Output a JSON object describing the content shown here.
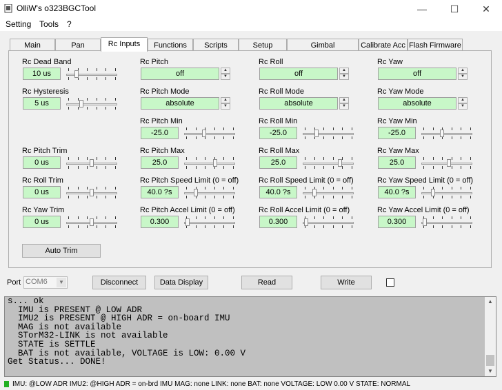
{
  "window": {
    "title": "OlliW's o323BGCTool",
    "min": "—",
    "max": "☐",
    "close": "✕"
  },
  "menu": [
    "Setting",
    "Tools",
    "?"
  ],
  "tabs": [
    "Main",
    "Pan",
    "Rc Inputs",
    "Functions",
    "Scripts",
    "Setup",
    "Gimbal Configuration",
    "Calibrate Acc",
    "Flash Firmware"
  ],
  "col1": {
    "dead_band": {
      "label": "Rc Dead Band",
      "value": "10 us",
      "slider": 0.18
    },
    "hysteresis": {
      "label": "Rc Hysteresis",
      "value": "5 us",
      "slider": 0.28
    },
    "pitch_trim": {
      "label": "Rc Pitch Trim",
      "value": "0 us",
      "slider": 0.5
    },
    "roll_trim": {
      "label": "Rc Roll Trim",
      "value": "0 us",
      "slider": 0.5
    },
    "yaw_trim": {
      "label": "Rc Yaw Trim",
      "value": "0 us",
      "slider": 0.5
    },
    "auto_trim": "Auto Trim"
  },
  "axes": [
    {
      "key": "pitch",
      "rc": "Rc Pitch",
      "rc_val": "off",
      "mode": "Rc Pitch Mode",
      "mode_val": "absolute",
      "min": "Rc Pitch Min",
      "min_val": "-25.0",
      "min_s": 0.38,
      "max": "Rc Pitch Max",
      "max_val": "25.0",
      "max_s": 0.62,
      "speed": "Rc Pitch Speed Limit (0 = off)",
      "speed_val": "40.0 ?s",
      "speed_s": 0.2,
      "accel": "Rc Pitch Accel Limit (0 = off)",
      "accel_val": "0.300",
      "accel_s": 0.03
    },
    {
      "key": "roll",
      "rc": "Rc Roll",
      "rc_val": "off",
      "mode": "Rc Roll Mode",
      "mode_val": "absolute",
      "min": "Rc Roll Min",
      "min_val": "-25.0",
      "min_s": 0.25,
      "max": "Rc Roll Max",
      "max_val": "25.0",
      "max_s": 0.75,
      "speed": "Rc Roll Speed Limit (0 = off)",
      "speed_val": "40.0 ?s",
      "speed_s": 0.2,
      "accel": "Rc Roll Accel Limit (0 = off)",
      "accel_val": "0.300",
      "accel_s": 0.03
    },
    {
      "key": "yaw",
      "rc": "Rc Yaw",
      "rc_val": "off",
      "mode": "Rc Yaw Mode",
      "mode_val": "absolute",
      "min": "Rc Yaw Min",
      "min_val": "-25.0",
      "min_s": 0.4,
      "max": "Rc Yaw Max",
      "max_val": "25.0",
      "max_s": 0.55,
      "speed": "Rc Yaw Speed Limit (0 = off)",
      "speed_val": "40.0 ?s",
      "speed_s": 0.2,
      "accel": "Rc Yaw Accel Limit (0 = off)",
      "accel_val": "0.300",
      "accel_s": 0.03
    }
  ],
  "port": {
    "label": "Port",
    "value": "COM6"
  },
  "buttons": {
    "disconnect": "Disconnect",
    "data_display": "Data Display",
    "read": "Read",
    "write": "Write"
  },
  "console_lines": [
    "s... ok",
    "  IMU is PRESENT @ LOW ADR",
    "  IMU2 is PRESENT @ HIGH ADR = on-board IMU",
    "  MAG is not available",
    "  STorM32-LINK is not available",
    "  STATE is SETTLE",
    "  BAT is not available, VOLTAGE is LOW: 0.00 V",
    "Get Status... DONE!"
  ],
  "status": "IMU: @LOW ADR   IMU2: @HIGH ADR = on-brd IMU    MAG: none    LINK: none    BAT: none    VOLTAGE: LOW 0.00 V    STATE: NORMAL",
  "colors": {
    "value_bg": "#c8f7c8",
    "console_bg": "#c0c0c0",
    "status_led": "#22b022"
  }
}
